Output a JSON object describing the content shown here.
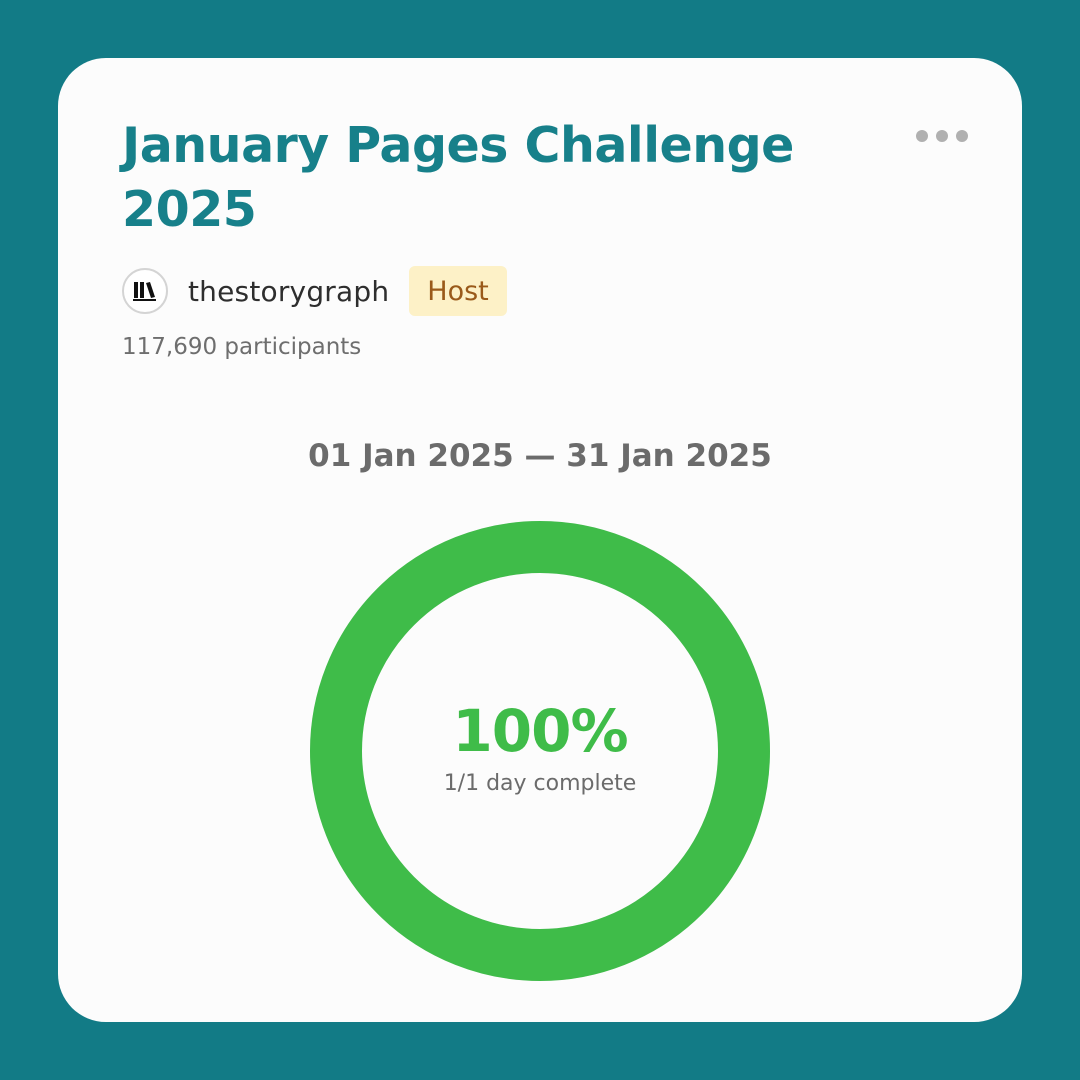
{
  "challenge": {
    "title": "January Pages Challenge 2025",
    "host_name": "thestorygraph",
    "host_badge": "Host",
    "participants": "117,690 participants",
    "date_range": "01 Jan 2025 — 31 Jan 2025"
  },
  "progress": {
    "percent_label": "100%",
    "percent_value": 100,
    "caption": "1/1 day complete"
  },
  "icons": {
    "menu": "more-horizontal-icon",
    "avatar": "books-logo-icon"
  },
  "colors": {
    "background": "#127b86",
    "title": "#17808a",
    "ring": "#3fbc49",
    "badge_bg": "#fdf1c7",
    "badge_text": "#9a5a1a"
  }
}
